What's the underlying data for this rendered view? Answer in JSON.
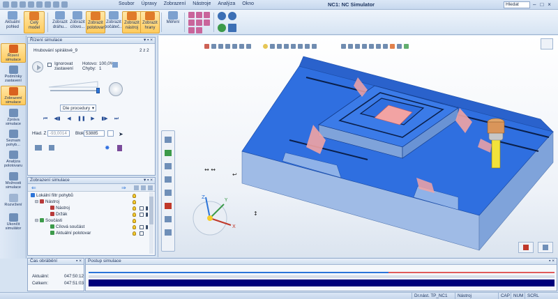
{
  "window": {
    "title": "NC1: NC Simulator",
    "search_placeholder": "Hledat",
    "menu": [
      "Soubor",
      "Úpravy",
      "Zobrazení",
      "Nástroje",
      "Analýza",
      "Okno"
    ]
  },
  "ribbon": {
    "buttons": [
      {
        "line1": "Aktuální",
        "line2": "pohled"
      },
      {
        "line1": "Celý model",
        "line2": ""
      },
      {
        "line1": "Zobrazit",
        "line2": "dráhu..."
      },
      {
        "line1": "Zobrazit",
        "line2": "cílovo..."
      },
      {
        "line1": "Zobrazit",
        "line2": "polotovar"
      },
      {
        "line1": "Zobrazit",
        "line2": "počáteč..."
      },
      {
        "line1": "Zobrazit",
        "line2": "nástroj"
      },
      {
        "line1": "Zobrazit",
        "line2": "hrany"
      },
      {
        "line1": "Měření",
        "line2": ""
      }
    ]
  },
  "leftnav": {
    "items": [
      {
        "line1": "Řízení",
        "line2": "simulace"
      },
      {
        "line1": "Podmínky",
        "line2": "zastavení"
      },
      {
        "line1": "Zobrazení",
        "line2": "simulace"
      },
      {
        "line1": "Zpráva",
        "line2": "simulace"
      },
      {
        "line1": "Seznam",
        "line2": "pohyb..."
      },
      {
        "line1": "Analýza",
        "line2": "polotovaru"
      },
      {
        "line1": "Možnosti",
        "line2": "simulace"
      },
      {
        "line1": "Rozvržení",
        "line2": ""
      },
      {
        "line1": "Ukončit",
        "line2": "simulátor"
      }
    ]
  },
  "simcontrol": {
    "title": "Řízení simulace",
    "operation": "Hrubování spirálové_9",
    "counter": "2 z 2",
    "ignore_stop_label": "Ignorovat",
    "ignore_stop_label2": "zastavení",
    "done_label": "Hotovo:",
    "done_value": "100,0%",
    "errors_label": "Chyby:",
    "errors_value": "1",
    "speed_fraction": 0.98,
    "mode_select": "Dle procedury",
    "hladz_label": "Hlad. Z",
    "hladz_value": "-93,0014",
    "blok_label": "Blok",
    "blok_value": "53885"
  },
  "simdisplay": {
    "title": "Zobrazení simulace",
    "rows": [
      {
        "text": "Lokální filtr pohybů",
        "indent": 0
      },
      {
        "text": "Nástroj",
        "indent": 1
      },
      {
        "text": "Nástroj",
        "indent": 2
      },
      {
        "text": "Držák",
        "indent": 2
      },
      {
        "text": "Součásti",
        "indent": 1
      },
      {
        "text": "Cílová součást",
        "indent": 2
      },
      {
        "text": "Aktuální polotovar",
        "indent": 2
      }
    ]
  },
  "times": {
    "title": "Čas obrábění",
    "current_label": "Aktuální:",
    "current_value": "047:50:12",
    "total_label": "Celkem:",
    "total_value": "047:51:03"
  },
  "progress": {
    "title": "Postup simulace",
    "fraction": 1.0
  },
  "status": {
    "text": "Dr.nást. TP_NC1",
    "tool": "Nástroj",
    "cap": "CAP",
    "num": "NUM",
    "scrl": "SCRL"
  },
  "colors": {
    "accent": "#ffcb5c",
    "stock_blue": "#2f6fe0",
    "stock_side": "#8fb2e8",
    "residual": "#f2a3a3",
    "progress": "#00007a"
  }
}
